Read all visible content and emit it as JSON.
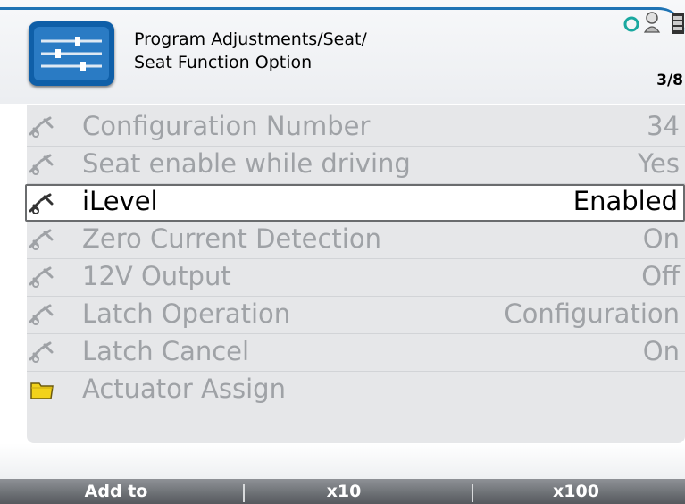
{
  "header": {
    "title_line1": "Program Adjustments/Seat/",
    "title_line2": "Seat Function Option",
    "page_counter": "3/8",
    "app_icon": "sliders-icon",
    "accent_color": "#1e73b4"
  },
  "list": {
    "items": [
      {
        "label": "Configuration Number",
        "value": "34",
        "icon": "wrench-settings-icon",
        "selected": false
      },
      {
        "label": "Seat enable while driving",
        "value": "Yes",
        "icon": "wrench-settings-icon",
        "selected": false
      },
      {
        "label": "iLevel",
        "value": "Enabled",
        "icon": "wrench-settings-icon",
        "selected": true
      },
      {
        "label": "Zero Current Detection",
        "value": "On",
        "icon": "wrench-settings-icon",
        "selected": false
      },
      {
        "label": "12V Output",
        "value": "Off",
        "icon": "wrench-settings-icon",
        "selected": false
      },
      {
        "label": "Latch Operation",
        "value": "Configuration",
        "icon": "wrench-settings-icon",
        "selected": false
      },
      {
        "label": "Latch Cancel",
        "value": "On",
        "icon": "wrench-settings-icon",
        "selected": false
      },
      {
        "label": "Actuator Assign",
        "value": "",
        "icon": "folder-icon",
        "selected": false
      }
    ]
  },
  "softkeys": {
    "left": "Add to",
    "middle": "x10",
    "right": "x100"
  }
}
